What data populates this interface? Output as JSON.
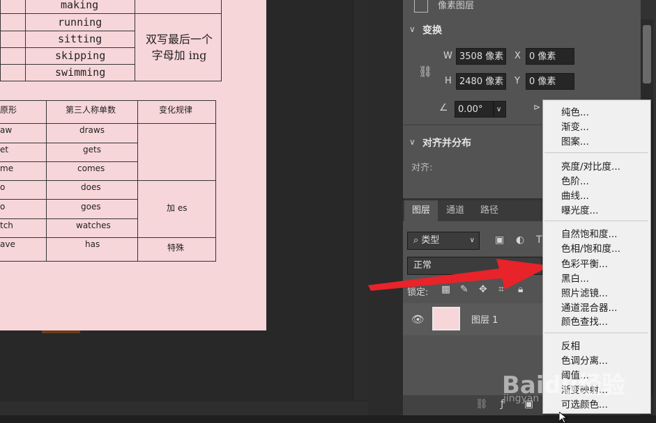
{
  "document": {
    "top_table": {
      "words": [
        "making",
        "running",
        "sitting",
        "skipping",
        "swimming"
      ],
      "rule": "双写最后一个\n字母加 ing"
    },
    "bottom_table": {
      "headers": [
        "原形",
        "第三人称单数",
        "变化规律"
      ],
      "base": [
        "aw",
        "et",
        "me",
        "o",
        "o",
        "tch",
        "ave"
      ],
      "third": [
        "draws",
        "gets",
        "comes",
        "does",
        "goes",
        "watches",
        "has"
      ],
      "rule_es": "加 es",
      "rule_special": "特殊"
    }
  },
  "panel": {
    "layer_kind": "像素图层",
    "transform": {
      "title": "变换",
      "w_label": "W",
      "w_value": "3508 像素",
      "h_label": "H",
      "h_value": "2480 像素",
      "x_label": "X",
      "x_value": "0 像素",
      "y_label": "Y",
      "y_value": "0 像素",
      "angle_value": "0.00°"
    },
    "align": {
      "title": "对齐并分布",
      "label": "对齐:"
    },
    "tabs": [
      "图层",
      "通道",
      "路径"
    ],
    "filter_kind": "类型",
    "blend_mode": "正常",
    "lock_label": "锁定:",
    "layer_name": "图层 1"
  },
  "menu": {
    "group1": [
      "纯色...",
      "渐变...",
      "图案..."
    ],
    "group2": [
      "亮度/对比度...",
      "色阶...",
      "曲线...",
      "曝光度..."
    ],
    "group3": [
      "自然饱和度...",
      "色相/饱和度...",
      "色彩平衡...",
      "黑白...",
      "照片滤镜...",
      "通道混合器...",
      "颜色查找..."
    ],
    "group4": [
      "反相",
      "色调分离...",
      "阈值...",
      "渐变映射...",
      "可选颜色..."
    ]
  },
  "watermark": {
    "logo": "Baidu经验",
    "url": "jingyan"
  }
}
